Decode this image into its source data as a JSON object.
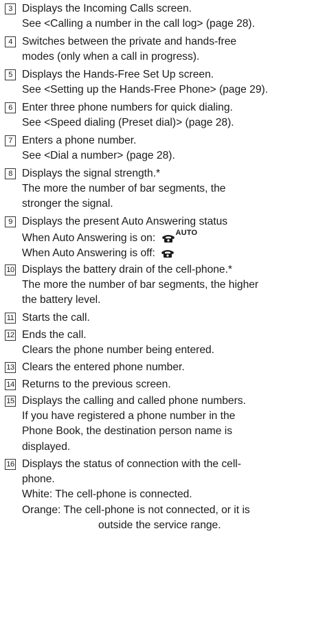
{
  "items": [
    {
      "num": "3",
      "lines": [
        "Displays the Incoming Calls screen.",
        "See <Calling a number in the call log> (page 28)."
      ]
    },
    {
      "num": "4",
      "lines": [
        "Switches between the private and hands-free",
        "modes (only when a call in progress)."
      ]
    },
    {
      "num": "5",
      "lines": [
        "Displays the Hands-Free Set Up screen.",
        "See <Setting up the Hands-Free Phone> (page 29)."
      ]
    },
    {
      "num": "6",
      "lines": [
        "Enter three phone numbers for quick dialing.",
        "See <Speed dialing (Preset dial)> (page 28)."
      ]
    },
    {
      "num": "7",
      "lines": [
        "Enters a phone number.",
        "See <Dial a number> (page 28)."
      ]
    },
    {
      "num": "8",
      "lines": [
        "Displays the signal strength.*",
        "The more the number of bar segments, the",
        "stronger the signal."
      ]
    },
    {
      "num": "9",
      "lines": [
        "Displays the present Auto Answering status",
        "When Auto Answering is on: ",
        "When Auto Answering is off: "
      ],
      "auto_label": "AUTO"
    },
    {
      "num": "10",
      "lines": [
        "Displays the battery drain of the cell-phone.*",
        "The more the number of bar segments, the higher",
        "the battery level."
      ]
    },
    {
      "num": "11",
      "lines": [
        "Starts the call."
      ]
    },
    {
      "num": "12",
      "lines": [
        "Ends the call.",
        "Clears the phone number being entered."
      ]
    },
    {
      "num": "13",
      "lines": [
        "Clears the entered phone number."
      ]
    },
    {
      "num": "14",
      "lines": [
        "Returns to the previous screen."
      ]
    },
    {
      "num": "15",
      "lines": [
        "Displays the calling and called phone numbers.",
        "If you have registered a phone number in the",
        "Phone Book, the destination person name is",
        "displayed."
      ]
    },
    {
      "num": "16",
      "lines": [
        "Displays the status of connection with the cell-",
        "phone.",
        "White: The cell-phone is connected.",
        "Orange: The cell-phone is not connected, or it is",
        "outside the service range."
      ]
    }
  ]
}
